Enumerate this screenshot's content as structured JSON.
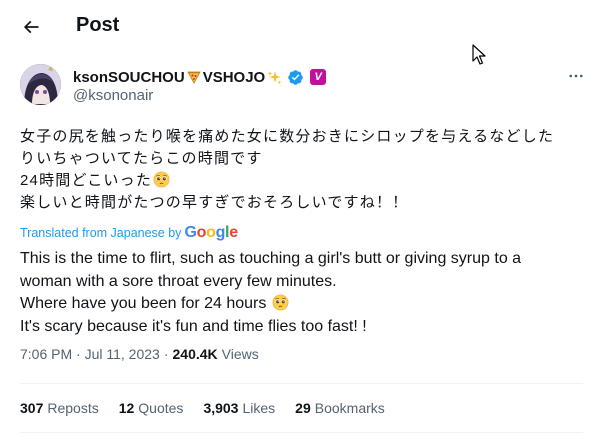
{
  "header": {
    "title": "Post"
  },
  "author": {
    "display_name": "ksonSOUCHOU",
    "display_name_suffix": "VSHOJO",
    "handle": "@ksononair",
    "badge_letter": "V",
    "verified_color": "#1d9bf0",
    "badge_color": "#c1109e"
  },
  "tweet": {
    "jp_lines": [
      "女子の尻を触ったり喉を痛めた女に数分おきにシロップを与えるなどした",
      "りいちゃついてたらこの時間です",
      "24時間どこいった",
      "楽しいと時間がたつの早すぎでおそろしいですね！！"
    ],
    "translated_label": "Translated from Japanese by",
    "google_letters": [
      "G",
      "o",
      "o",
      "g",
      "l",
      "e"
    ],
    "en_lines": [
      "This is the time to flirt, such as touching a girl's butt or giving syrup to a",
      "woman with a sore throat every few minutes.",
      "Where have you been for 24 hours",
      "It's scary because it's fun and time flies too fast! !"
    ]
  },
  "meta": {
    "time": "7:06 PM · Jul 11, 2023",
    "separator": "·",
    "views_count": "240.4K",
    "views_label": "Views"
  },
  "stats": [
    {
      "count": "307",
      "label": "Reposts"
    },
    {
      "count": "12",
      "label": "Quotes"
    },
    {
      "count": "3,903",
      "label": "Likes"
    },
    {
      "count": "29",
      "label": "Bookmarks"
    }
  ],
  "icons": {
    "back": "arrow-left-icon",
    "more": "ellipsis-icon",
    "verified": "verified-check-icon",
    "pizza": "pizza-emoji-icon",
    "sparkles": "sparkles-emoji-icon",
    "pleading": "pleading-face-emoji-icon",
    "cursor": "mouse-pointer-icon"
  },
  "colors": {
    "accent": "#1d9bf0",
    "text": "#0f1419",
    "secondary": "#536471",
    "divider": "#eff3f4"
  }
}
